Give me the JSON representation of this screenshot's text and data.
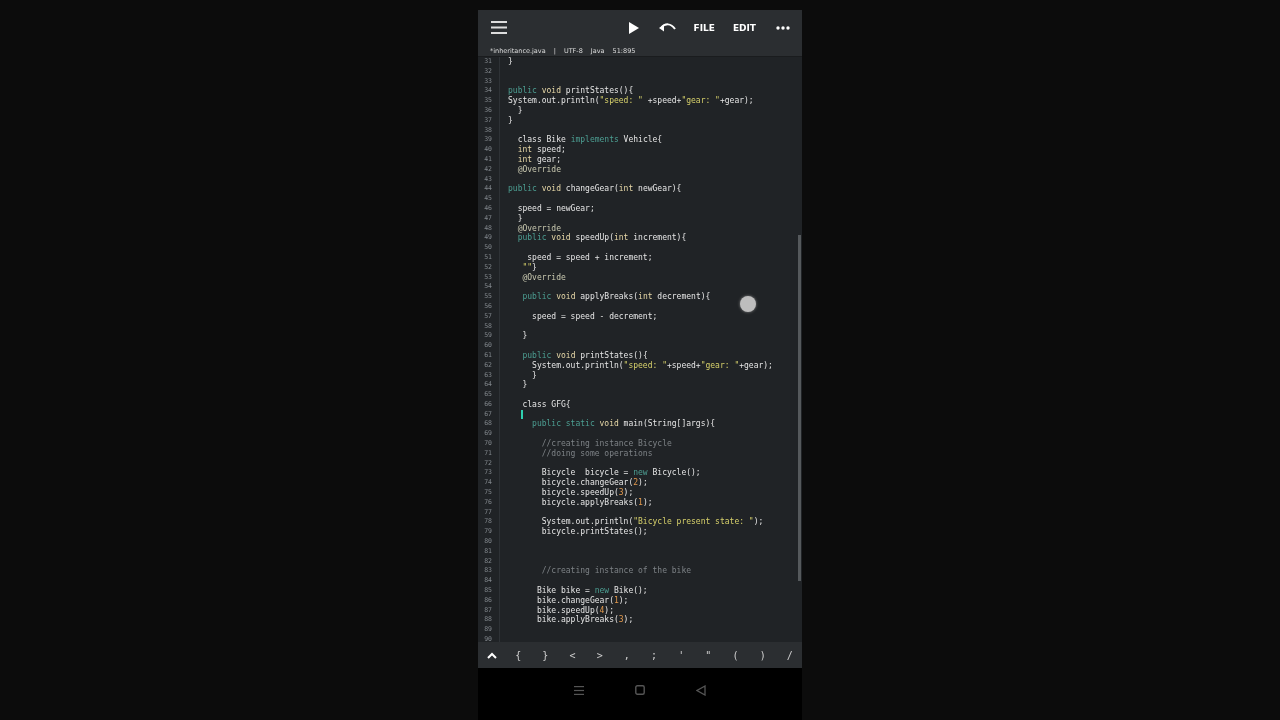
{
  "toolbar": {
    "actions": [
      {
        "kind": "run"
      },
      {
        "kind": "undo"
      },
      {
        "kind": "text",
        "label": "FILE"
      },
      {
        "kind": "text",
        "label": "EDIT"
      },
      {
        "kind": "more"
      }
    ]
  },
  "file_info": {
    "file_name": "*inheritance.java",
    "separator": "|",
    "encoding": "UTF-8",
    "language": "Java",
    "position": "51:895"
  },
  "editor": {
    "lines": [
      {
        "number": "31",
        "segments": [
          {
            "text": "}",
            "kind": "plain"
          }
        ]
      },
      {
        "number": "32"
      },
      {
        "number": "33"
      },
      {
        "number": "34",
        "segments": [
          {
            "text": "public",
            "kind": "kw"
          },
          {
            "text": " void",
            "kind": "type"
          },
          {
            "text": " printStates(){",
            "kind": "plain"
          }
        ]
      },
      {
        "number": "35",
        "segments": [
          {
            "text": "System.out.println(",
            "kind": "plain"
          },
          {
            "text": "\"speed: \"",
            "kind": "str"
          },
          {
            "text": " +speed+",
            "kind": "plain"
          },
          {
            "text": "\"gear: \"",
            "kind": "str"
          },
          {
            "text": "+gear);",
            "kind": "plain"
          }
        ]
      },
      {
        "number": "36",
        "segments": [
          {
            "text": "  }",
            "kind": "plain"
          }
        ]
      },
      {
        "number": "37",
        "segments": [
          {
            "text": "}",
            "kind": "plain"
          }
        ]
      },
      {
        "number": "38"
      },
      {
        "number": "39",
        "segments": [
          {
            "text": "  class Bike ",
            "kind": "plain"
          },
          {
            "text": "implements",
            "kind": "kw"
          },
          {
            "text": " Vehicle{",
            "kind": "plain"
          }
        ]
      },
      {
        "number": "40",
        "segments": [
          {
            "text": "  int",
            "kind": "type"
          },
          {
            "text": " speed;",
            "kind": "plain"
          }
        ]
      },
      {
        "number": "41",
        "segments": [
          {
            "text": "  int",
            "kind": "type"
          },
          {
            "text": " gear;",
            "kind": "plain"
          }
        ]
      },
      {
        "number": "42",
        "segments": [
          {
            "text": "  @Override",
            "kind": "ann"
          }
        ]
      },
      {
        "number": "43"
      },
      {
        "number": "44",
        "segments": [
          {
            "text": "public",
            "kind": "kw"
          },
          {
            "text": " void",
            "kind": "type"
          },
          {
            "text": " changeGear(",
            "kind": "plain"
          },
          {
            "text": "int",
            "kind": "type"
          },
          {
            "text": " newGear){",
            "kind": "plain"
          }
        ]
      },
      {
        "number": "45"
      },
      {
        "number": "46",
        "segments": [
          {
            "text": "  speed = newGear;",
            "kind": "plain"
          }
        ]
      },
      {
        "number": "47",
        "segments": [
          {
            "text": "  }",
            "kind": "plain"
          }
        ]
      },
      {
        "number": "48",
        "segments": [
          {
            "text": "  @Override",
            "kind": "ann"
          }
        ]
      },
      {
        "number": "49",
        "segments": [
          {
            "text": "  public",
            "kind": "kw"
          },
          {
            "text": " void",
            "kind": "type"
          },
          {
            "text": " speedUp(",
            "kind": "plain"
          },
          {
            "text": "int",
            "kind": "type"
          },
          {
            "text": " increment){",
            "kind": "plain"
          }
        ]
      },
      {
        "number": "50"
      },
      {
        "number": "51",
        "segments": [
          {
            "text": "    speed = speed + increment;",
            "kind": "plain"
          }
        ]
      },
      {
        "number": "52",
        "segments": [
          {
            "text": "   \"\"",
            "kind": "str"
          },
          {
            "text": "}",
            "kind": "plain"
          }
        ]
      },
      {
        "number": "53",
        "segments": [
          {
            "text": "   @Override",
            "kind": "ann"
          }
        ]
      },
      {
        "number": "54"
      },
      {
        "number": "55",
        "segments": [
          {
            "text": "   public",
            "kind": "kw"
          },
          {
            "text": " void",
            "kind": "type"
          },
          {
            "text": " applyBreaks(",
            "kind": "plain"
          },
          {
            "text": "int",
            "kind": "type"
          },
          {
            "text": " decrement){",
            "kind": "plain"
          }
        ]
      },
      {
        "number": "56"
      },
      {
        "number": "57",
        "segments": [
          {
            "text": "     speed = speed - decrement;",
            "kind": "plain"
          }
        ]
      },
      {
        "number": "58"
      },
      {
        "number": "59",
        "segments": [
          {
            "text": "   }",
            "kind": "plain"
          }
        ]
      },
      {
        "number": "60"
      },
      {
        "number": "61",
        "segments": [
          {
            "text": "   public",
            "kind": "kw"
          },
          {
            "text": " void",
            "kind": "type"
          },
          {
            "text": " printStates(){",
            "kind": "plain"
          }
        ]
      },
      {
        "number": "62",
        "segments": [
          {
            "text": "     System.out.println(",
            "kind": "plain"
          },
          {
            "text": "\"speed: \"",
            "kind": "str"
          },
          {
            "text": "+speed+",
            "kind": "plain"
          },
          {
            "text": "\"gear: \"",
            "kind": "str"
          },
          {
            "text": "+gear);",
            "kind": "plain"
          }
        ]
      },
      {
        "number": "63",
        "segments": [
          {
            "text": "     }",
            "kind": "plain"
          }
        ]
      },
      {
        "number": "64",
        "segments": [
          {
            "text": "   }",
            "kind": "plain"
          }
        ]
      },
      {
        "number": "65"
      },
      {
        "number": "66",
        "segments": [
          {
            "text": "   class GFG{",
            "kind": "plain"
          }
        ]
      },
      {
        "number": "67",
        "cursor": true
      },
      {
        "number": "68",
        "segments": [
          {
            "text": "     public static",
            "kind": "kw"
          },
          {
            "text": " void",
            "kind": "type"
          },
          {
            "text": " main(String[]args){",
            "kind": "plain"
          }
        ]
      },
      {
        "number": "69"
      },
      {
        "number": "70",
        "segments": [
          {
            "text": "       //creating instance Bicycle",
            "kind": "comment"
          }
        ]
      },
      {
        "number": "71",
        "segments": [
          {
            "text": "       //doing some operations",
            "kind": "comment"
          }
        ]
      },
      {
        "number": "72"
      },
      {
        "number": "73",
        "segments": [
          {
            "text": "       Bicycle  bicycle = ",
            "kind": "plain"
          },
          {
            "text": "new",
            "kind": "kw"
          },
          {
            "text": " Bicycle();",
            "kind": "plain"
          }
        ]
      },
      {
        "number": "74",
        "segments": [
          {
            "text": "       bicycle.changeGear(",
            "kind": "plain"
          },
          {
            "text": "2",
            "kind": "num"
          },
          {
            "text": ");",
            "kind": "plain"
          }
        ]
      },
      {
        "number": "75",
        "segments": [
          {
            "text": "       bicycle.speedUp(",
            "kind": "plain"
          },
          {
            "text": "3",
            "kind": "num"
          },
          {
            "text": ");",
            "kind": "plain"
          }
        ]
      },
      {
        "number": "76",
        "segments": [
          {
            "text": "       bicycle.applyBreaks(",
            "kind": "plain"
          },
          {
            "text": "1",
            "kind": "num"
          },
          {
            "text": ");",
            "kind": "plain"
          }
        ]
      },
      {
        "number": "77"
      },
      {
        "number": "78",
        "segments": [
          {
            "text": "       System.out.println(",
            "kind": "plain"
          },
          {
            "text": "\"Bicycle present state: \"",
            "kind": "str"
          },
          {
            "text": ");",
            "kind": "plain"
          }
        ]
      },
      {
        "number": "79",
        "segments": [
          {
            "text": "       bicycle.printStates();",
            "kind": "plain"
          }
        ]
      },
      {
        "number": "80"
      },
      {
        "number": "81"
      },
      {
        "number": "82"
      },
      {
        "number": "83",
        "segments": [
          {
            "text": "       //creating instance of the bike",
            "kind": "comment"
          }
        ]
      },
      {
        "number": "84"
      },
      {
        "number": "85",
        "segments": [
          {
            "text": "      Bike bike = ",
            "kind": "plain"
          },
          {
            "text": "new",
            "kind": "kw"
          },
          {
            "text": " Bike();",
            "kind": "plain"
          }
        ]
      },
      {
        "number": "86",
        "segments": [
          {
            "text": "      bike.changeGear(",
            "kind": "plain"
          },
          {
            "text": "1",
            "kind": "num"
          },
          {
            "text": ");",
            "kind": "plain"
          }
        ]
      },
      {
        "number": "87",
        "segments": [
          {
            "text": "      bike.speedUp(",
            "kind": "plain"
          },
          {
            "text": "4",
            "kind": "num"
          },
          {
            "text": ");",
            "kind": "plain"
          }
        ]
      },
      {
        "number": "88",
        "segments": [
          {
            "text": "      bike.applyBreaks(",
            "kind": "plain"
          },
          {
            "text": "3",
            "kind": "num"
          },
          {
            "text": ");",
            "kind": "plain"
          }
        ]
      },
      {
        "number": "89"
      },
      {
        "number": "90"
      }
    ]
  },
  "symbol_bar": {
    "keys": [
      "{",
      "}",
      "<",
      ">",
      ",",
      ";",
      "'",
      "\"",
      "(",
      ")",
      "/"
    ]
  }
}
